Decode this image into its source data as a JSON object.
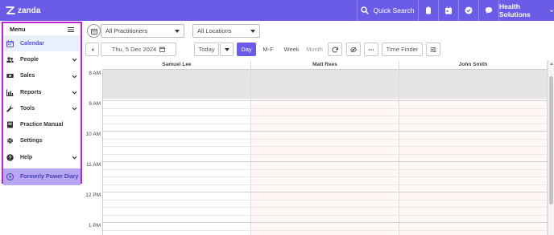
{
  "topbar": {
    "logo_text": "zanda",
    "search_label": "Quick Search",
    "org_name": "Health Solutions",
    "icons": [
      "search-icon",
      "clipboard-icon",
      "calendar-icon",
      "check-circle-icon",
      "chat-icon",
      "chevron-down-icon"
    ],
    "color": "#6b5ce7"
  },
  "sidebar": {
    "header": "Menu",
    "items": [
      {
        "label": "Calendar",
        "icon": "calendar-icon",
        "expandable": false,
        "active": true
      },
      {
        "label": "People",
        "icon": "people-icon",
        "expandable": true
      },
      {
        "label": "Sales",
        "icon": "cash-icon",
        "expandable": true
      },
      {
        "label": "Reports",
        "icon": "chart-icon",
        "expandable": true
      },
      {
        "label": "Tools",
        "icon": "wrench-icon",
        "expandable": true
      },
      {
        "label": "Practice Manual",
        "icon": "book-icon",
        "expandable": false
      },
      {
        "label": "Settings",
        "icon": "gear-icon",
        "expandable": false
      },
      {
        "label": "Help",
        "icon": "help-icon",
        "expandable": true
      },
      {
        "label": "Formerly Power Diary",
        "icon": "power-diary-icon",
        "expandable": false
      }
    ],
    "border_color": "#c020d8"
  },
  "filters": {
    "practitioners": "All Practitioners",
    "locations": "All Locations"
  },
  "toolbar": {
    "date": "Thu, 5 Dec 2024",
    "today": "Today",
    "views": [
      "Day",
      "M-F",
      "Week",
      "Month"
    ],
    "active_view": "Day",
    "time_finder": "Time Finder"
  },
  "calendar": {
    "practitioners": [
      "Samuel Lee",
      "Matt Rees",
      "John Smith"
    ],
    "times": [
      "8 AM",
      "9 AM",
      "10 AM",
      "11 AM",
      "12 PM",
      "1 PM"
    ]
  }
}
